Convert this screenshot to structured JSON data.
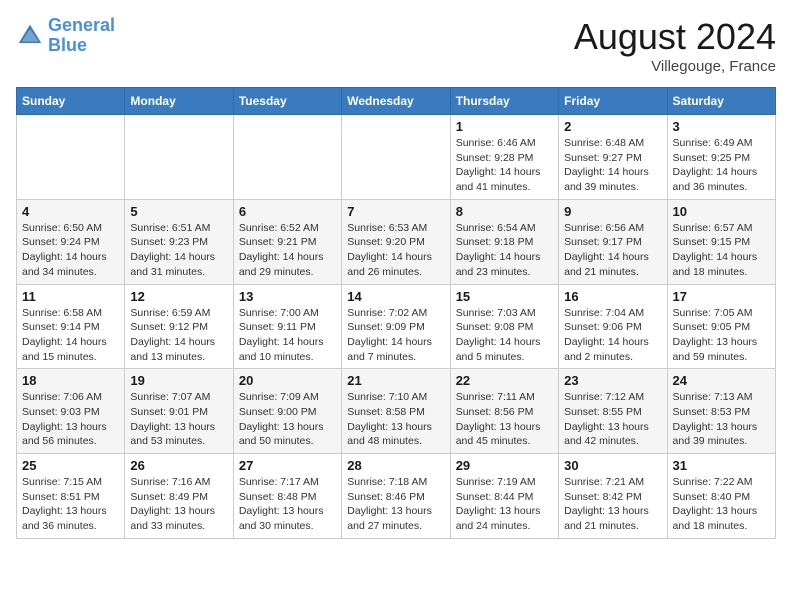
{
  "header": {
    "logo_line1": "General",
    "logo_line2": "Blue",
    "month_title": "August 2024",
    "location": "Villegouge, France"
  },
  "weekdays": [
    "Sunday",
    "Monday",
    "Tuesday",
    "Wednesday",
    "Thursday",
    "Friday",
    "Saturday"
  ],
  "weeks": [
    [
      {
        "day": "",
        "info": ""
      },
      {
        "day": "",
        "info": ""
      },
      {
        "day": "",
        "info": ""
      },
      {
        "day": "",
        "info": ""
      },
      {
        "day": "1",
        "info": "Sunrise: 6:46 AM\nSunset: 9:28 PM\nDaylight: 14 hours\nand 41 minutes."
      },
      {
        "day": "2",
        "info": "Sunrise: 6:48 AM\nSunset: 9:27 PM\nDaylight: 14 hours\nand 39 minutes."
      },
      {
        "day": "3",
        "info": "Sunrise: 6:49 AM\nSunset: 9:25 PM\nDaylight: 14 hours\nand 36 minutes."
      }
    ],
    [
      {
        "day": "4",
        "info": "Sunrise: 6:50 AM\nSunset: 9:24 PM\nDaylight: 14 hours\nand 34 minutes."
      },
      {
        "day": "5",
        "info": "Sunrise: 6:51 AM\nSunset: 9:23 PM\nDaylight: 14 hours\nand 31 minutes."
      },
      {
        "day": "6",
        "info": "Sunrise: 6:52 AM\nSunset: 9:21 PM\nDaylight: 14 hours\nand 29 minutes."
      },
      {
        "day": "7",
        "info": "Sunrise: 6:53 AM\nSunset: 9:20 PM\nDaylight: 14 hours\nand 26 minutes."
      },
      {
        "day": "8",
        "info": "Sunrise: 6:54 AM\nSunset: 9:18 PM\nDaylight: 14 hours\nand 23 minutes."
      },
      {
        "day": "9",
        "info": "Sunrise: 6:56 AM\nSunset: 9:17 PM\nDaylight: 14 hours\nand 21 minutes."
      },
      {
        "day": "10",
        "info": "Sunrise: 6:57 AM\nSunset: 9:15 PM\nDaylight: 14 hours\nand 18 minutes."
      }
    ],
    [
      {
        "day": "11",
        "info": "Sunrise: 6:58 AM\nSunset: 9:14 PM\nDaylight: 14 hours\nand 15 minutes."
      },
      {
        "day": "12",
        "info": "Sunrise: 6:59 AM\nSunset: 9:12 PM\nDaylight: 14 hours\nand 13 minutes."
      },
      {
        "day": "13",
        "info": "Sunrise: 7:00 AM\nSunset: 9:11 PM\nDaylight: 14 hours\nand 10 minutes."
      },
      {
        "day": "14",
        "info": "Sunrise: 7:02 AM\nSunset: 9:09 PM\nDaylight: 14 hours\nand 7 minutes."
      },
      {
        "day": "15",
        "info": "Sunrise: 7:03 AM\nSunset: 9:08 PM\nDaylight: 14 hours\nand 5 minutes."
      },
      {
        "day": "16",
        "info": "Sunrise: 7:04 AM\nSunset: 9:06 PM\nDaylight: 14 hours\nand 2 minutes."
      },
      {
        "day": "17",
        "info": "Sunrise: 7:05 AM\nSunset: 9:05 PM\nDaylight: 13 hours\nand 59 minutes."
      }
    ],
    [
      {
        "day": "18",
        "info": "Sunrise: 7:06 AM\nSunset: 9:03 PM\nDaylight: 13 hours\nand 56 minutes."
      },
      {
        "day": "19",
        "info": "Sunrise: 7:07 AM\nSunset: 9:01 PM\nDaylight: 13 hours\nand 53 minutes."
      },
      {
        "day": "20",
        "info": "Sunrise: 7:09 AM\nSunset: 9:00 PM\nDaylight: 13 hours\nand 50 minutes."
      },
      {
        "day": "21",
        "info": "Sunrise: 7:10 AM\nSunset: 8:58 PM\nDaylight: 13 hours\nand 48 minutes."
      },
      {
        "day": "22",
        "info": "Sunrise: 7:11 AM\nSunset: 8:56 PM\nDaylight: 13 hours\nand 45 minutes."
      },
      {
        "day": "23",
        "info": "Sunrise: 7:12 AM\nSunset: 8:55 PM\nDaylight: 13 hours\nand 42 minutes."
      },
      {
        "day": "24",
        "info": "Sunrise: 7:13 AM\nSunset: 8:53 PM\nDaylight: 13 hours\nand 39 minutes."
      }
    ],
    [
      {
        "day": "25",
        "info": "Sunrise: 7:15 AM\nSunset: 8:51 PM\nDaylight: 13 hours\nand 36 minutes."
      },
      {
        "day": "26",
        "info": "Sunrise: 7:16 AM\nSunset: 8:49 PM\nDaylight: 13 hours\nand 33 minutes."
      },
      {
        "day": "27",
        "info": "Sunrise: 7:17 AM\nSunset: 8:48 PM\nDaylight: 13 hours\nand 30 minutes."
      },
      {
        "day": "28",
        "info": "Sunrise: 7:18 AM\nSunset: 8:46 PM\nDaylight: 13 hours\nand 27 minutes."
      },
      {
        "day": "29",
        "info": "Sunrise: 7:19 AM\nSunset: 8:44 PM\nDaylight: 13 hours\nand 24 minutes."
      },
      {
        "day": "30",
        "info": "Sunrise: 7:21 AM\nSunset: 8:42 PM\nDaylight: 13 hours\nand 21 minutes."
      },
      {
        "day": "31",
        "info": "Sunrise: 7:22 AM\nSunset: 8:40 PM\nDaylight: 13 hours\nand 18 minutes."
      }
    ]
  ]
}
